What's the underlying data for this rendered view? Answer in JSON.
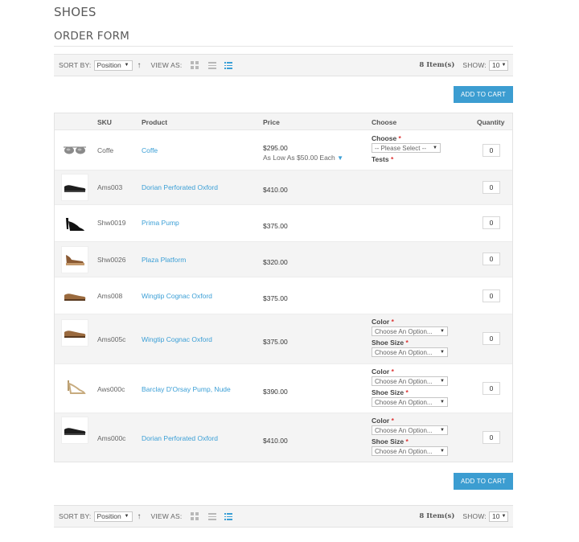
{
  "page": {
    "category": "SHOES",
    "form_title": "ORDER FORM"
  },
  "toolbar": {
    "sort_label": "SORT BY:",
    "sort_value": "Position",
    "view_label": "VIEW AS:",
    "item_count": "8 Item(s)",
    "show_label": "SHOW:",
    "show_value": "10"
  },
  "cart_button_label": "ADD TO CART",
  "columns": {
    "sku": "SKU",
    "product": "Product",
    "price": "Price",
    "choose": "Choose",
    "quantity": "Quantity"
  },
  "rows": [
    {
      "sku": "Coffe",
      "product": "Coffe",
      "price": "$295.00",
      "price_note": "As Low As $50.00 Each",
      "quantity": "0",
      "options": [
        {
          "label": "Choose",
          "value": "-- Please Select --"
        },
        {
          "label": "Tests",
          "value": ""
        }
      ],
      "image": "sunglasses"
    },
    {
      "sku": "Ams003",
      "product": "Dorian Perforated Oxford",
      "price": "$410.00",
      "quantity": "0",
      "image": "black-oxford"
    },
    {
      "sku": "Shw0019",
      "product": "Prima Pump",
      "price": "$375.00",
      "quantity": "0",
      "image": "black-pump"
    },
    {
      "sku": "Shw0026",
      "product": "Plaza Platform",
      "price": "$320.00",
      "quantity": "0",
      "image": "platform-wedge"
    },
    {
      "sku": "Ams008",
      "product": "Wingtip Cognac Oxford",
      "price": "$375.00",
      "quantity": "0",
      "image": "brown-wingtip"
    },
    {
      "sku": "Ams005c",
      "product": "Wingtip Cognac Oxford",
      "price": "$375.00",
      "quantity": "0",
      "options": [
        {
          "label": "Color",
          "value": "Choose An Option..."
        },
        {
          "label": "Shoe Size",
          "value": "Choose An Option..."
        }
      ],
      "image": "brown-wingtip"
    },
    {
      "sku": "Aws000c",
      "product": "Barclay D'Orsay Pump, Nude",
      "price": "$390.00",
      "quantity": "0",
      "options": [
        {
          "label": "Color",
          "value": "Choose An Option..."
        },
        {
          "label": "Shoe Size",
          "value": "Choose An Option..."
        }
      ],
      "image": "nude-pump"
    },
    {
      "sku": "Ams000c",
      "product": "Dorian Perforated Oxford",
      "price": "$410.00",
      "quantity": "0",
      "options": [
        {
          "label": "Color",
          "value": "Choose An Option..."
        },
        {
          "label": "Shoe Size",
          "value": "Choose An Option..."
        }
      ],
      "image": "black-oxford"
    }
  ],
  "colors": {
    "accent": "#3c9dd1",
    "required": "#dd3333",
    "toolbar_bg": "#f4f4f4"
  }
}
